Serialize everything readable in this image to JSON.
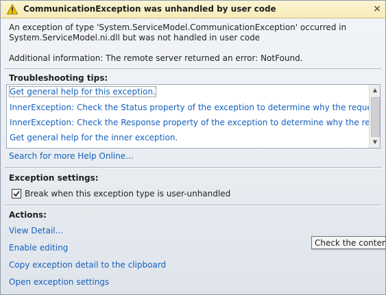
{
  "dialog": {
    "title": "CommunicationException was unhandled by user code",
    "close_glyph": "×",
    "message_line1": "An exception of type 'System.ServiceModel.CommunicationException' occurred in",
    "message_line2": "System.ServiceModel.ni.dll but was not handled in user code",
    "additional_info": "Additional information: The remote server returned an error: NotFound."
  },
  "troubleshooting": {
    "heading": "Troubleshooting tips:",
    "tips": [
      "Get general help for this exception.",
      "InnerException: Check the Status property of the exception to determine why the request failed.",
      "InnerException: Check the Response property of the exception to determine why the request failed.",
      "Get general help for the inner exception."
    ],
    "search_link": "Search for more Help Online..."
  },
  "exception_settings": {
    "heading": "Exception settings:",
    "checkbox_label": "Break when this exception type is user-unhandled",
    "checked": true
  },
  "actions": {
    "heading": "Actions:",
    "items": [
      "View Detail...",
      "Enable editing",
      "Copy exception detail to the clipboard",
      "Open exception settings"
    ]
  },
  "tooltip": {
    "text": "Check the content o"
  },
  "colors": {
    "link": "#1560bd",
    "title_bar": "#f6ebb7",
    "warning_icon": "#f5c400"
  }
}
